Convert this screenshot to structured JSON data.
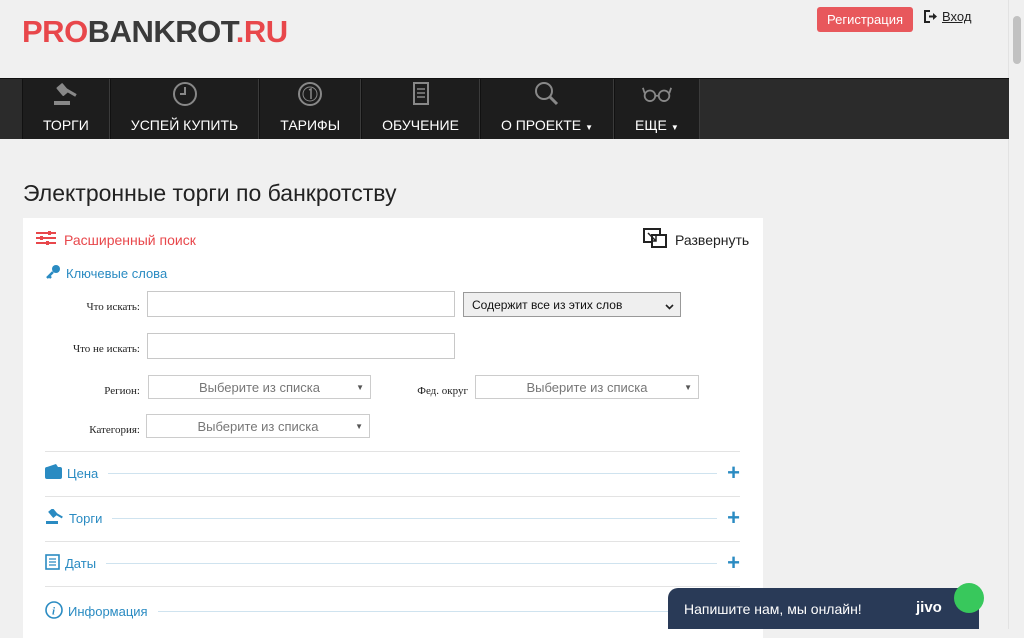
{
  "header": {
    "logo": {
      "pro": "PRO",
      "main": "BANKR",
      "o": "O",
      "rest": "T",
      "ru": ".RU"
    },
    "register_label": "Регистрация",
    "login_label": "Вход"
  },
  "nav": [
    {
      "label": "ТОРГИ",
      "icon": "gavel-icon",
      "caret": false
    },
    {
      "label": "УСПЕЙ КУПИТЬ",
      "icon": "clock-icon",
      "caret": false
    },
    {
      "label": "ТАРИФЫ",
      "icon": "coin-icon",
      "caret": false
    },
    {
      "label": "ОБУЧЕНИЕ",
      "icon": "document-icon",
      "caret": false
    },
    {
      "label": "О ПРОЕКТЕ",
      "icon": "search-icon",
      "caret": true
    },
    {
      "label": "ЕЩЕ",
      "icon": "glasses-icon",
      "caret": true
    }
  ],
  "page_title": "Электронные торги по банкротству",
  "search": {
    "advanced_label": "Расширенный поиск",
    "expand_label": "Развернуть",
    "keywords_label": "Ключевые слова",
    "what_label": "Что искать:",
    "what_value": "",
    "match_option": "Содержит все из этих слов",
    "not_label": "Что не искать:",
    "not_value": "",
    "region_label": "Регион:",
    "region_placeholder": "Выберите из списка",
    "fed_label": "Фед. округ",
    "fed_placeholder": "Выберите из списка",
    "category_label": "Категория:",
    "category_placeholder": "Выберите из списка"
  },
  "sections": [
    {
      "label": "Цена",
      "icon": "wallet-icon"
    },
    {
      "label": "Торги",
      "icon": "gavel-icon"
    },
    {
      "label": "Даты",
      "icon": "document-icon"
    },
    {
      "label": "Информация",
      "icon": "info-icon"
    }
  ],
  "chat": {
    "text": "Напишите нам, мы онлайн!",
    "brand": "jivo"
  }
}
